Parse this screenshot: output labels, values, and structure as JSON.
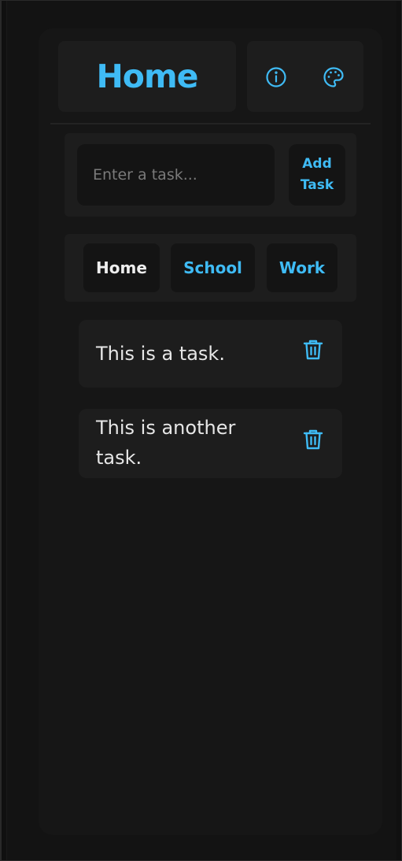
{
  "header": {
    "title": "Home",
    "icons": [
      "info-icon",
      "palette-icon"
    ]
  },
  "input": {
    "placeholder": "Enter a task...",
    "value": "",
    "add_button_line1": "Add",
    "add_button_line2": "Task"
  },
  "tabs": [
    {
      "label": "Home",
      "active": true
    },
    {
      "label": "School",
      "active": false
    },
    {
      "label": "Work",
      "active": false
    }
  ],
  "tasks": [
    {
      "text": "This is a task.",
      "action_icon": "trash-icon"
    },
    {
      "text": "This is another task.",
      "action_icon": "trash-icon"
    }
  ],
  "colors": {
    "accent": "#3fbbf5",
    "background": "#131313",
    "app": "#161616",
    "panel": "#1d1d1d",
    "field": "#141414",
    "text": "#e6e6e6",
    "placeholder": "#7a7a7a"
  }
}
